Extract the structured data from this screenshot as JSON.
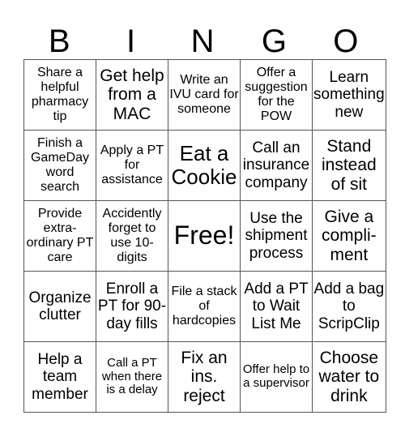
{
  "header": [
    "B",
    "I",
    "N",
    "G",
    "O"
  ],
  "cells": [
    [
      "Share a helpful pharmacy tip",
      "Get help from a MAC",
      "Write an IVU card for someone",
      "Offer a suggestion for the POW",
      "Learn something new"
    ],
    [
      "Finish a GameDay word search",
      "Apply a PT for assistance",
      "Eat a Cookie",
      "Call an insurance company",
      "Stand instead of sit"
    ],
    [
      "Provide extra-ordinary PT care",
      "Accidently forget to use 10-digits",
      "Free!",
      "Use the shipment process",
      "Give a compli-ment"
    ],
    [
      "Organize clutter",
      "Enroll a PT for 90-day fills",
      "File a stack of hardcopies",
      "Add a PT to Wait List Me",
      "Add a bag to ScripClip"
    ],
    [
      "Help a team member",
      "Call a PT when there is a delay",
      "Fix an ins. reject",
      "Offer help to a supervisor",
      "Choose water to drink"
    ]
  ]
}
